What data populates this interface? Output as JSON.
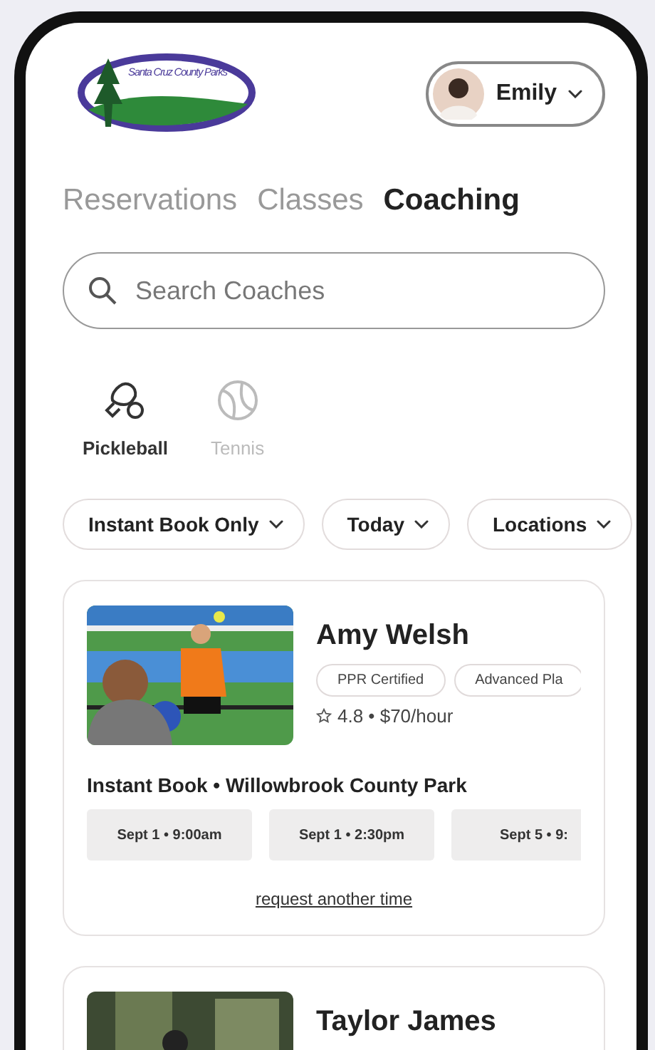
{
  "header": {
    "logo_text": "Santa Cruz County Parks",
    "user": {
      "name": "Emily"
    }
  },
  "tabs": [
    {
      "label": "Reservations",
      "selected": false
    },
    {
      "label": "Classes",
      "selected": false
    },
    {
      "label": "Coaching",
      "selected": true
    }
  ],
  "search": {
    "placeholder": "Search Coaches"
  },
  "sports": [
    {
      "label": "Pickleball",
      "kind": "pickleball",
      "selected": true
    },
    {
      "label": "Tennis",
      "kind": "tennis",
      "selected": false
    }
  ],
  "filters": [
    "Instant Book Only",
    "Today",
    "Locations"
  ],
  "coaches": [
    {
      "name": "Amy Welsh",
      "kind": "picture",
      "tags": [
        "PPR Certified",
        "Advanced Pla"
      ],
      "rating": "4.8 • $70/hour",
      "booking": "Instant Book • Willowbrook County Park",
      "slots": [
        "Sept 1 • 9:00am",
        "Sept 1 • 2:30pm",
        "Sept 5 • 9:"
      ],
      "link": "request another time"
    },
    {
      "name": "Taylor James",
      "kind": "picture"
    }
  ]
}
